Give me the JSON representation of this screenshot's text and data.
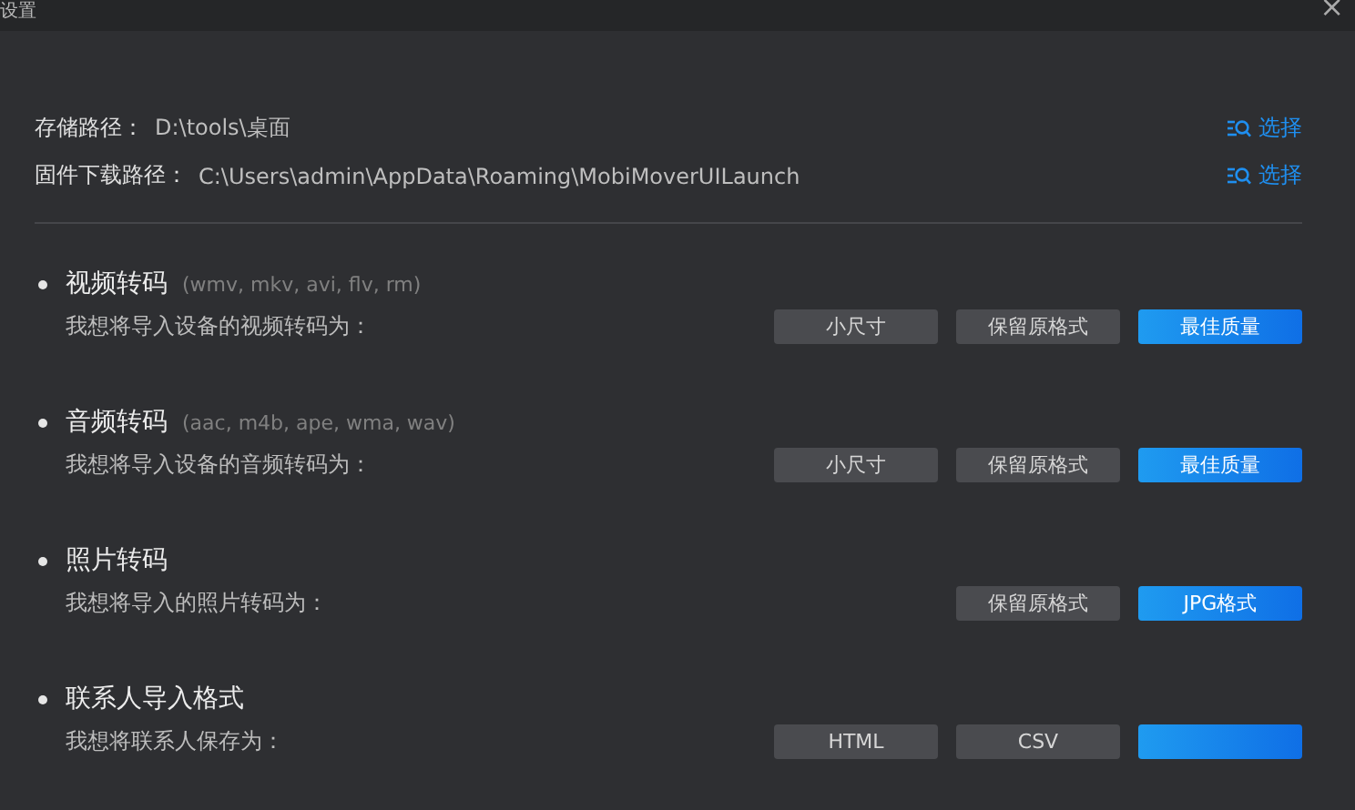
{
  "window": {
    "title": "设置",
    "close": "×"
  },
  "paths": [
    {
      "label": "存储路径：",
      "value": "D:\\tools\\桌面",
      "action": "选择"
    },
    {
      "label": "固件下载路径：",
      "value": "C:\\Users\\admin\\AppData\\Roaming\\MobiMoverUILaunch",
      "action": "选择"
    }
  ],
  "sections": [
    {
      "title": "视频转码",
      "formats": "(wmv, mkv, avi, flv, rm)",
      "prompt": "我想将导入设备的视频转码为：",
      "options": [
        {
          "label": "小尺寸",
          "selected": false
        },
        {
          "label": "保留原格式",
          "selected": false
        },
        {
          "label": "最佳质量",
          "selected": true
        }
      ]
    },
    {
      "title": "音频转码",
      "formats": "(aac, m4b, ape, wma, wav)",
      "prompt": "我想将导入设备的音频转码为：",
      "options": [
        {
          "label": "小尺寸",
          "selected": false
        },
        {
          "label": "保留原格式",
          "selected": false
        },
        {
          "label": "最佳质量",
          "selected": true
        }
      ]
    },
    {
      "title": "照片转码",
      "prompt": "我想将导入的照片转码为：",
      "options": [
        {
          "label": "保留原格式",
          "selected": false
        },
        {
          "label": "JPG格式",
          "selected": true
        }
      ]
    },
    {
      "title": "联系人导入格式",
      "prompt": "我想将联系人保存为：",
      "options": [
        {
          "label": "HTML",
          "selected": false
        },
        {
          "label": "CSV",
          "selected": false
        },
        {
          "selected": true
        }
      ]
    }
  ]
}
